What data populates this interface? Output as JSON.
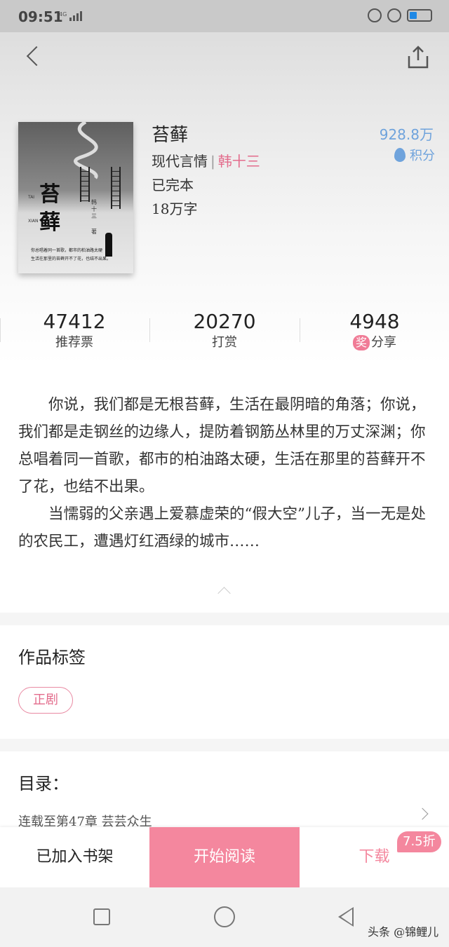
{
  "status_bar": {
    "time": "09:51",
    "network": "4G"
  },
  "book": {
    "title": "苔藓",
    "genre": "现代言情",
    "separator": "|",
    "author": "韩十三",
    "status": "已完本",
    "word_count": "18万字",
    "score_value": "928.8万",
    "score_label": "积分",
    "cover": {
      "title_line1": "苔",
      "title_line2": "藓",
      "pinyin_top": "TAI",
      "pinyin_bottom": "XIAN",
      "author": "韩十三",
      "author_suffix": "著",
      "tagline1": "你总唱着同一首歌，都市的柏油路太硬",
      "tagline2": "生活在那里的苔藓开不了花，也结不出果。"
    }
  },
  "stats": [
    {
      "value": "47412",
      "label": "推荐票"
    },
    {
      "value": "20270",
      "label": "打赏"
    },
    {
      "value": "4948",
      "badge": "奖",
      "label": "分享"
    }
  ],
  "synopsis": {
    "paragraph1": "你说，我们都是无根苔藓，生活在最阴暗的角落；你说，我们都是走钢丝的边缘人，提防着钢筋丛林里的万丈深渊；你总唱着同一首歌，都市的柏油路太硬，生活在那里的苔藓开不了花，也结不出果。",
    "paragraph2": "当懦弱的父亲遇上爱慕虚荣的“假大空”儿子，当一无是处的农民工，遭遇灯红酒绿的城市……"
  },
  "tags_section": {
    "title": "作品标签",
    "tags": [
      "正剧"
    ]
  },
  "toc": {
    "title": "目录：",
    "latest": "连载至第47章 芸芸众生"
  },
  "bottom_bar": {
    "shelf": "已加入书架",
    "read": "开始阅读",
    "download": "下载",
    "discount": "7.5折"
  },
  "watermark": "头条 @锦鲤儿",
  "colors": {
    "accent_pink": "#f4879e",
    "author_pink": "#e36c8c",
    "score_blue": "#6fa3dc"
  }
}
